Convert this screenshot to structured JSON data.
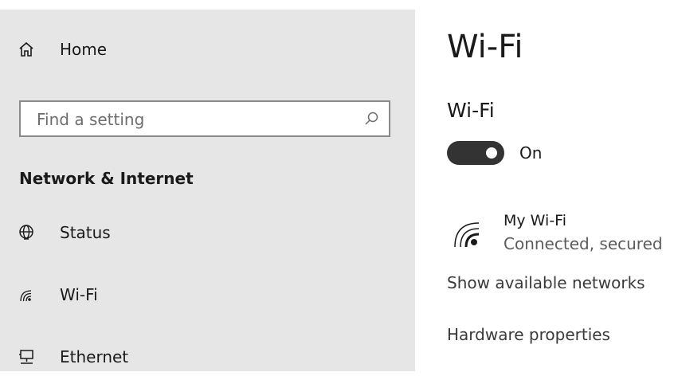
{
  "sidebar": {
    "home_label": "Home",
    "search": {
      "placeholder": "Find a setting",
      "value": ""
    },
    "section_title": "Network & Internet",
    "items": [
      {
        "label": "Status",
        "icon": "globe-icon"
      },
      {
        "label": "Wi-Fi",
        "icon": "wifi-icon"
      },
      {
        "label": "Ethernet",
        "icon": "ethernet-icon"
      }
    ]
  },
  "main": {
    "page_title": "Wi-Fi",
    "wifi_section_title": "Wi-Fi",
    "toggle": {
      "state_label": "On",
      "on": true
    },
    "network": {
      "name": "My Wi-Fi",
      "status": "Connected, secured",
      "icon": "wifi-signal-icon"
    },
    "links": {
      "show_available": "Show available networks",
      "hardware_properties": "Hardware properties"
    }
  },
  "colors": {
    "sidebar_bg": "#e6e6e6",
    "toggle_on": "#333333",
    "text": "#1a1a1a",
    "secondary_text": "#5c5c5c"
  }
}
